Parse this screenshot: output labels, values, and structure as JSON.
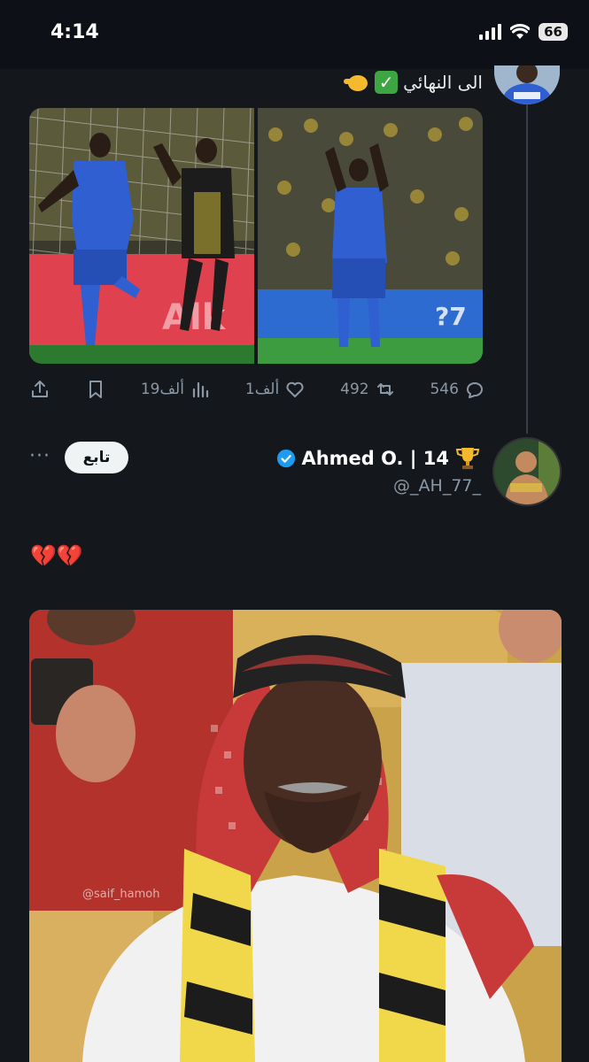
{
  "status_bar": {
    "time": "4:14",
    "battery": "66"
  },
  "tweet1": {
    "text": "الى النهائي",
    "emojis": [
      "check-mark-emoji",
      "pointing-hand-emoji"
    ],
    "stats": {
      "replies": "546",
      "retweets": "492",
      "likes": "1ألف",
      "views": "19ألف"
    }
  },
  "tweet2": {
    "display_name": "Ahmed O. | 14",
    "handle": "@_AH_77_",
    "follow_label": "تابع",
    "more": "···",
    "text": "💔💔",
    "watermark": "@saif_hamoh"
  },
  "colors": {
    "background": "#14171c",
    "verified": "#1d9bf0",
    "accent_blue": "#2f5fd0"
  }
}
